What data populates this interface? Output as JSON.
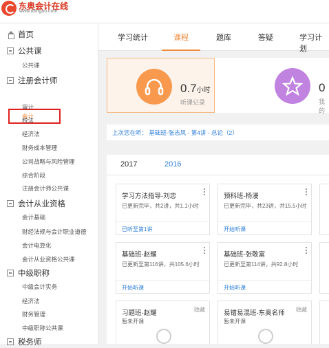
{
  "brand": {
    "name": "东奥会计在线",
    "url_text": "www.dongao.com"
  },
  "sidebar": {
    "home": "首页",
    "sections": [
      {
        "label": "公共课",
        "items": [
          "公共课"
        ]
      },
      {
        "label": "注册会计师",
        "items": [
          "会计",
          "审计",
          "税法",
          "经济法",
          "财务成本管理",
          "公司战略与风险管理",
          "综合阶段",
          "注册会计师公共课"
        ]
      },
      {
        "label": "会计从业资格",
        "items": [
          "会计基础",
          "财经法规与会计职业道德",
          "会计电算化",
          "会计从业资格公共课"
        ]
      },
      {
        "label": "中级职称",
        "items": [
          "中级会计实务",
          "经济法",
          "财务管理",
          "中级职称公共课"
        ]
      },
      {
        "label": "税务师",
        "items": []
      }
    ]
  },
  "tabs": [
    "学习统计",
    "课程",
    "题库",
    "答疑",
    "学习计划"
  ],
  "stats": {
    "listen_value": "0.7",
    "listen_unit": "小时",
    "listen_label": "听课记录",
    "second_value": "0",
    "second_label": "我的"
  },
  "last_visit": "上次您在听：  基础班-张志凤 - 第4讲 - 总论（2）",
  "years": [
    "2017",
    "2016"
  ],
  "courses": [
    {
      "title": "学习方法指导-刘忠",
      "progress": "已更新完毕，共2讲，共1.1小时",
      "action": "已听至第1讲"
    },
    {
      "title": "预科班-杨漫",
      "progress": "已更新完毕，共23讲，共15.5小时",
      "action": "开始听课"
    },
    {
      "title": "基础班-赵耀",
      "progress": "已更新至第116讲，共105.6小时",
      "action": "开始听课"
    },
    {
      "title": "基础班-张敬富",
      "progress": "已更新至第114讲，共92.8小时",
      "action": "开始听课"
    },
    {
      "title": "习题班-赵耀",
      "hidden": "隐藏",
      "status": "暂未开课"
    },
    {
      "title": "易错易混班-东奥名师",
      "hidden": "隐藏",
      "status": "暂未开课"
    }
  ],
  "colors": {
    "accent": "#f18a3a",
    "link": "#2e7fd8",
    "highlight_box": "#e02020"
  }
}
